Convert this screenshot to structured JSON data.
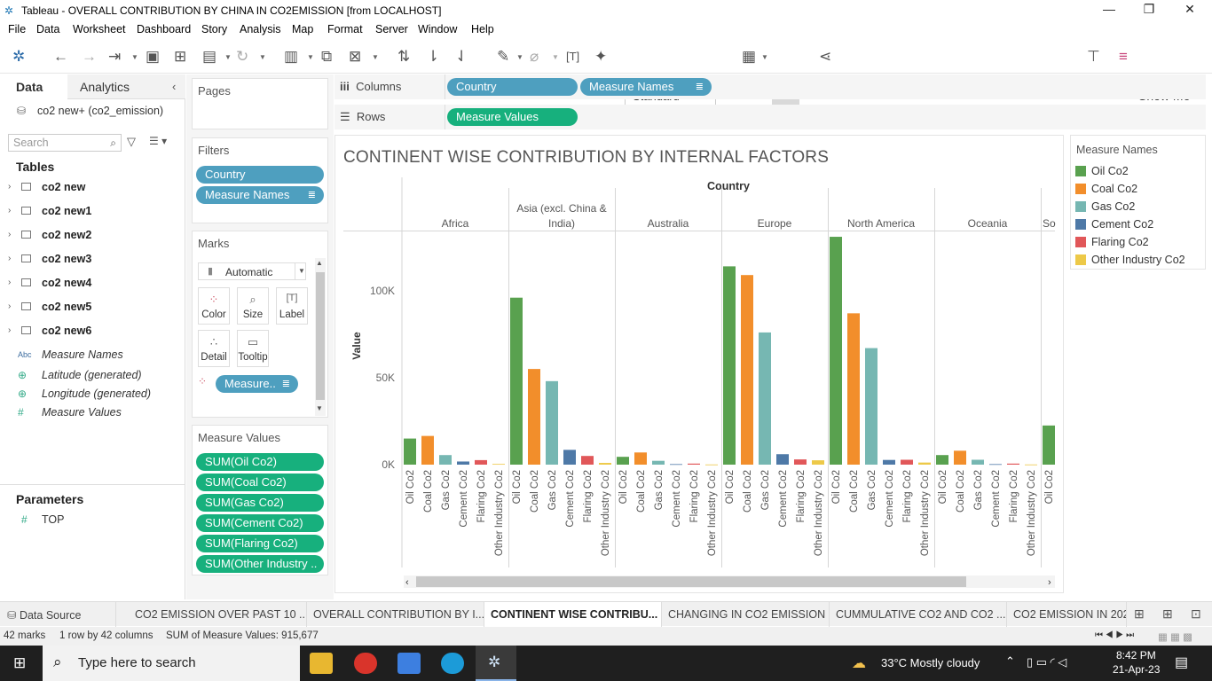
{
  "window": {
    "title": "Tableau - OVERALL CONTRIBUTION BY CHINA IN CO2EMISSION [from LOCALHOST]"
  },
  "menu": [
    "File",
    "Data",
    "Worksheet",
    "Dashboard",
    "Story",
    "Analysis",
    "Map",
    "Format",
    "Server",
    "Window",
    "Help"
  ],
  "toolbar": {
    "fit_mode": "Standard",
    "show_me": "Show Me"
  },
  "left_pane": {
    "tab_data": "Data",
    "tab_analytics": "Analytics",
    "datasource": "co2 new+ (co2_emission)",
    "search_placeholder": "Search",
    "tables_heading": "Tables",
    "tables": [
      "co2 new",
      "co2 new1",
      "co2 new2",
      "co2 new3",
      "co2 new4",
      "co2 new5",
      "co2 new6"
    ],
    "fields": [
      {
        "icon": "Abc",
        "label": "Measure Names"
      },
      {
        "icon": "globe",
        "label": "Latitude (generated)"
      },
      {
        "icon": "globe",
        "label": "Longitude (generated)"
      },
      {
        "icon": "#",
        "label": "Measure Values"
      }
    ],
    "parameters_heading": "Parameters",
    "parameters": [
      {
        "icon": "#",
        "label": "TOP"
      }
    ]
  },
  "cards": {
    "pages": "Pages",
    "filters": "Filters",
    "filter_pills": [
      "Country",
      "Measure Names"
    ],
    "marks": "Marks",
    "mark_type": "Automatic",
    "mark_buttons": [
      "Color",
      "Size",
      "Label",
      "Detail",
      "Tooltip"
    ],
    "marks_pill": "Measure..",
    "measure_values": "Measure Values",
    "measure_pills": [
      "SUM(Oil Co2)",
      "SUM(Coal Co2)",
      "SUM(Gas Co2)",
      "SUM(Cement Co2)",
      "SUM(Flaring Co2)",
      "SUM(Other Industry .."
    ]
  },
  "shelves": {
    "columns_label": "Columns",
    "rows_label": "Rows",
    "columns_pills": [
      "Country",
      "Measure Names"
    ],
    "rows_pills": [
      "Measure Values"
    ]
  },
  "chart_data": {
    "type": "bar",
    "title": "CONTINENT WISE CONTRIBUTION BY INTERNAL FACTORS",
    "header": "Country",
    "ylabel": "Value",
    "ylim": [
      0,
      140000
    ],
    "yticks": [
      {
        "v": 0,
        "t": "0K"
      },
      {
        "v": 50000,
        "t": "50K"
      },
      {
        "v": 100000,
        "t": "100K"
      }
    ],
    "measures": [
      "Oil Co2",
      "Coal Co2",
      "Gas Co2",
      "Cement Co2",
      "Flaring Co2",
      "Other Industry Co2"
    ],
    "colors": [
      "#59a14f",
      "#f28e2b",
      "#76b7b2",
      "#4e79a7",
      "#e15759",
      "#edc948"
    ],
    "categories": [
      "Africa",
      "Asia (excl. China & India)",
      "Australia",
      "Europe",
      "North America",
      "Oceania",
      "So"
    ],
    "series": [
      {
        "name": "Oil Co2",
        "values": [
          15000,
          96000,
          4500,
          114000,
          131000,
          5500,
          22500
        ]
      },
      {
        "name": "Coal Co2",
        "values": [
          16500,
          55000,
          7000,
          109000,
          87000,
          8000,
          null
        ]
      },
      {
        "name": "Gas Co2",
        "values": [
          5500,
          48000,
          2200,
          76000,
          67000,
          2800,
          null
        ]
      },
      {
        "name": "Cement Co2",
        "values": [
          1800,
          8500,
          300,
          6000,
          2700,
          300,
          null
        ]
      },
      {
        "name": "Flaring Co2",
        "values": [
          2600,
          5000,
          600,
          3000,
          2800,
          600,
          null
        ]
      },
      {
        "name": "Other Industry Co2",
        "values": [
          400,
          1000,
          100,
          2500,
          1200,
          100,
          null
        ]
      }
    ]
  },
  "legend": {
    "title": "Measure Names",
    "items": [
      "Oil Co2",
      "Coal Co2",
      "Gas Co2",
      "Cement Co2",
      "Flaring Co2",
      "Other Industry Co2"
    ]
  },
  "sheet_tabs": [
    "Data Source",
    "CO2 EMISSION OVER PAST 10 ...",
    "OVERALL CONTRIBUTION BY I...",
    "CONTINENT WISE CONTRIBU...",
    "CHANGING IN CO2 EMISSION",
    "CUMMULATIVE CO2 AND CO2 ...",
    "CO2 EMISSION IN 2020"
  ],
  "status": {
    "marks": "42 marks",
    "dims": "1 row by 42 columns",
    "sum": "SUM of Measure Values: 915,677"
  },
  "taskbar": {
    "search": "Type here to search",
    "weather": "33°C  Mostly cloudy",
    "time": "8:42 PM",
    "date": "21-Apr-23"
  }
}
